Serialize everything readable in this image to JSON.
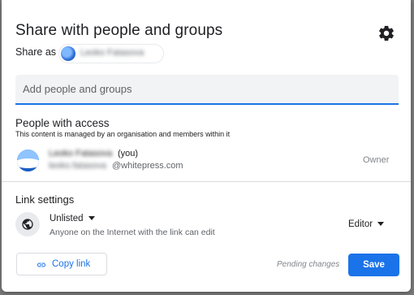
{
  "dialog": {
    "title": "Share with people and groups",
    "share_as_label": "Share as",
    "account_name": "Leoko Fatasova"
  },
  "add_people": {
    "placeholder": "Add people and groups"
  },
  "people_with_access": {
    "title": "People with access",
    "subtitle": "This content is managed by an organisation and members within it",
    "users": [
      {
        "name": "Leoko Fatasova",
        "you_label": "(you)",
        "email_local": "leoko.fatasova",
        "email_domain": "@whitepress.com",
        "role": "Owner"
      }
    ]
  },
  "link_settings": {
    "title": "Link settings",
    "visibility": "Unlisted",
    "description": "Anyone on the Internet with the link can edit",
    "role": "Editor"
  },
  "footer": {
    "copy_link_label": "Copy link",
    "pending_label": "Pending changes",
    "save_label": "Save"
  },
  "colors": {
    "accent": "#1a73e8",
    "input_bg": "#f1f3f4",
    "muted_text": "#80868b"
  },
  "icons": [
    "settings-gear-icon",
    "globe-icon",
    "link-icon",
    "chevron-down-icon"
  ]
}
